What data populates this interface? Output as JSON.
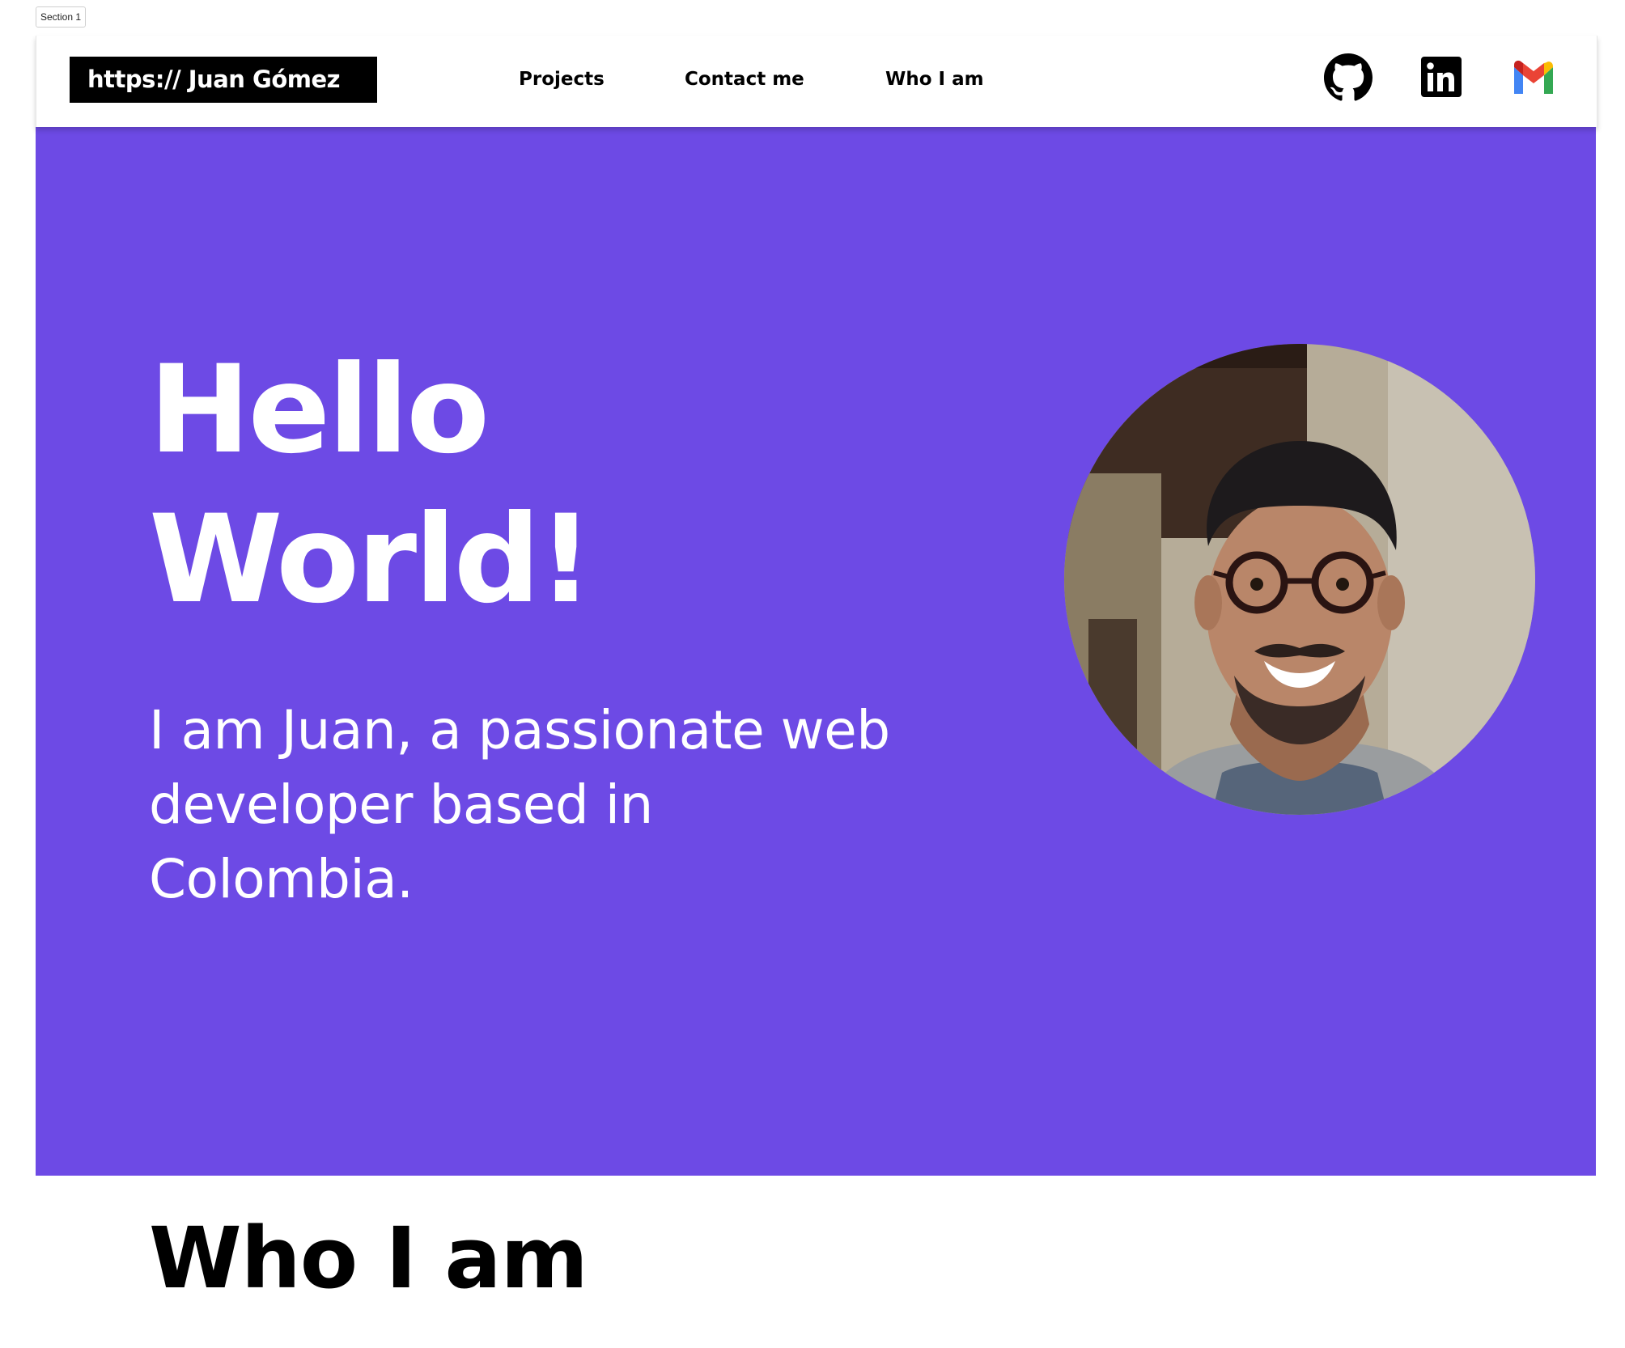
{
  "frame": {
    "label": "Section 1"
  },
  "header": {
    "brand": "https:// Juan Gómez",
    "nav": [
      {
        "label": "Projects"
      },
      {
        "label": "Contact me"
      },
      {
        "label": "Who I am"
      }
    ],
    "social_icons": [
      "github-icon",
      "linkedin-icon",
      "gmail-icon"
    ]
  },
  "hero": {
    "heading_line1": "Hello",
    "heading_line2": "World!",
    "subtitle": "I am Juan, a passionate web developer based in Colombia.",
    "background_color": "#6d4ae5"
  },
  "about": {
    "title": "Who I am"
  }
}
